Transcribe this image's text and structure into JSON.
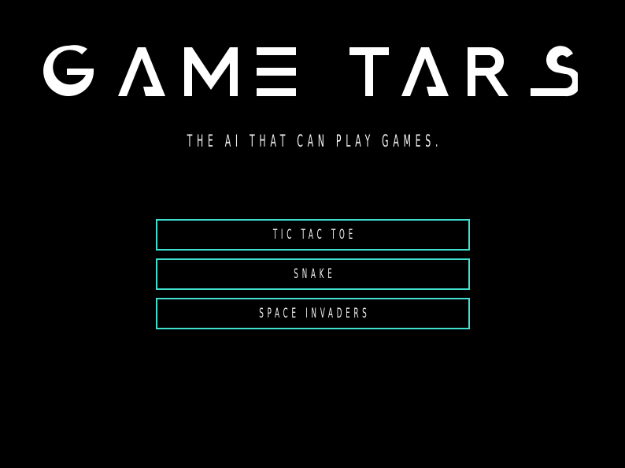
{
  "logo": {
    "text": "GAME TARS"
  },
  "tagline": "THE AI THAT CAN PLAY GAMES.",
  "menu": {
    "items": [
      {
        "label": "TIC TAC TOE"
      },
      {
        "label": "SNAKE"
      },
      {
        "label": "SPACE INVADERS"
      }
    ]
  },
  "colors": {
    "background": "#000000",
    "text": "#f2f2f2",
    "accent": "#40e0d0"
  }
}
